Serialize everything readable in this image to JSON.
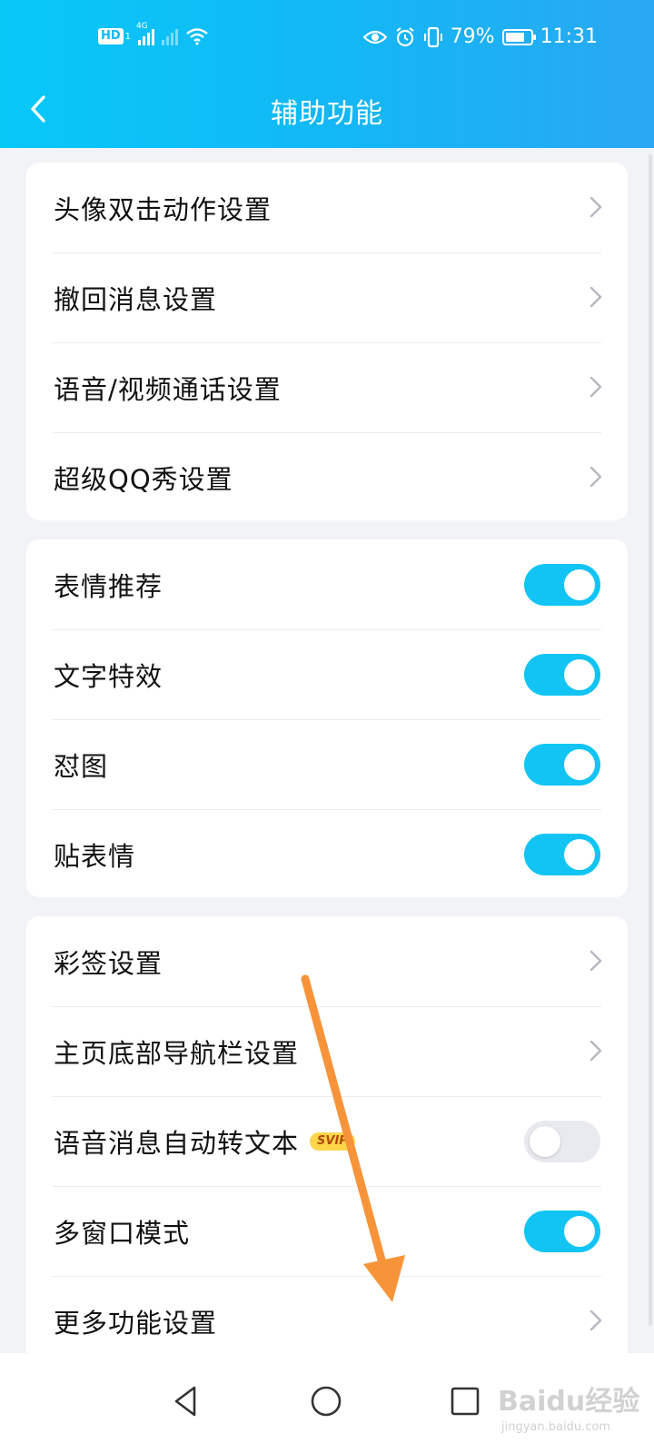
{
  "status_bar": {
    "hd_label": "HD",
    "hd_sub": "1",
    "network_label": "4G",
    "battery_percent": "79%",
    "battery_level": 0.79,
    "time": "11:31",
    "icons": [
      "hd-icon",
      "signal-icon",
      "no-signal-icon",
      "wifi-icon",
      "eye-icon",
      "alarm-icon",
      "vibrate-icon",
      "battery-icon"
    ]
  },
  "header": {
    "title": "辅助功能",
    "back_icon": "chevron-left-icon"
  },
  "groups": [
    {
      "items": [
        {
          "label": "头像双击动作设置",
          "control": "chevron"
        },
        {
          "label": "撤回消息设置",
          "control": "chevron"
        },
        {
          "label": "语音/视频通话设置",
          "control": "chevron"
        },
        {
          "label": "超级QQ秀设置",
          "control": "chevron"
        }
      ]
    },
    {
      "items": [
        {
          "label": "表情推荐",
          "control": "toggle",
          "enabled": true
        },
        {
          "label": "文字特效",
          "control": "toggle",
          "enabled": true
        },
        {
          "label": "怼图",
          "control": "toggle",
          "enabled": true
        },
        {
          "label": "贴表情",
          "control": "toggle",
          "enabled": true
        }
      ]
    },
    {
      "items": [
        {
          "label": "彩签设置",
          "control": "chevron"
        },
        {
          "label": "主页底部导航栏设置",
          "control": "chevron"
        },
        {
          "label": "语音消息自动转文本",
          "control": "toggle",
          "enabled": false,
          "badge": "SVIP"
        },
        {
          "label": "多窗口模式",
          "control": "toggle",
          "enabled": true
        },
        {
          "label": "更多功能设置",
          "control": "chevron"
        }
      ]
    }
  ],
  "bottom_nav": {
    "icons": [
      "back-triangle-icon",
      "home-circle-icon",
      "recents-square-icon"
    ]
  },
  "watermark": {
    "text": "Baidu经验",
    "sub": "jingyan.baidu.com"
  },
  "colors": {
    "accent": "#12c4f4",
    "header_start": "#08c8f8",
    "header_end": "#2aa8f2",
    "background": "#f2f3f7",
    "toggle_off": "#e8eaef",
    "annotation_arrow": "#f7943a"
  }
}
